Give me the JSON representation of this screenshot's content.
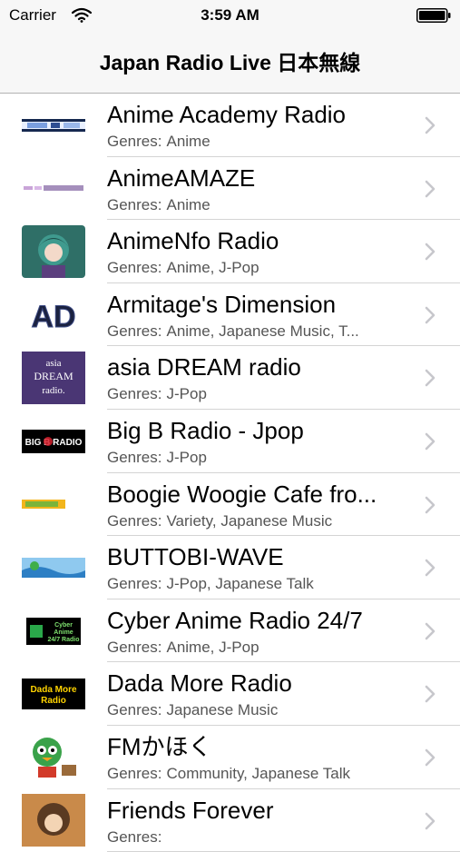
{
  "status_bar": {
    "carrier": "Carrier",
    "time": "3:59 AM",
    "icons": [
      "wifi-icon",
      "battery-icon"
    ]
  },
  "nav": {
    "title": "Japan Radio Live 日本無線"
  },
  "stations": [
    {
      "name": "Anime Academy Radio",
      "genres_label": "Genres:",
      "genres": "Anime",
      "logo_icon": "anime-academy-logo-icon"
    },
    {
      "name": "AnimeAMAZE",
      "genres_label": "Genres:",
      "genres": "Anime",
      "logo_icon": "animeamaze-logo-icon"
    },
    {
      "name": "AnimeNfo Radio",
      "genres_label": "Genres:",
      "genres": "Anime, J-Pop",
      "logo_icon": "animenfo-logo-icon"
    },
    {
      "name": "Armitage's Dimension",
      "genres_label": "Genres:",
      "genres": "Anime, Japanese Music, T...",
      "logo_icon": "armitage-logo-icon",
      "logo_text": "AD"
    },
    {
      "name": "asia DREAM radio",
      "genres_label": "Genres:",
      "genres": "J-Pop",
      "logo_icon": "asia-dream-logo-icon",
      "logo_text": "asia DREAM radio"
    },
    {
      "name": "Big B Radio - Jpop",
      "genres_label": "Genres:",
      "genres": "J-Pop",
      "logo_icon": "big-b-radio-logo-icon",
      "logo_text": "BIG B RADIO"
    },
    {
      "name": "Boogie Woogie Cafe fro...",
      "genres_label": "Genres:",
      "genres": "Variety, Japanese Music",
      "logo_icon": "boogie-woogie-logo-icon"
    },
    {
      "name": "BUTTOBI-WAVE",
      "genres_label": "Genres:",
      "genres": "J-Pop, Japanese Talk",
      "logo_icon": "buttobi-wave-logo-icon"
    },
    {
      "name": "Cyber Anime Radio 24/7",
      "genres_label": "Genres:",
      "genres": "Anime, J-Pop",
      "logo_icon": "cyber-anime-logo-icon",
      "logo_text": "Cyber Anime 24/7 Radio"
    },
    {
      "name": "Dada More Radio",
      "genres_label": "Genres:",
      "genres": "Japanese Music",
      "logo_icon": "dada-more-logo-icon",
      "logo_text": "Dada More Radio"
    },
    {
      "name": "FMかほく",
      "genres_label": "Genres:",
      "genres": "Community, Japanese Talk",
      "logo_icon": "fm-kahoku-logo-icon"
    },
    {
      "name": "Friends Forever",
      "genres_label": "Genres:",
      "genres": "",
      "logo_icon": "friends-forever-logo-icon"
    }
  ],
  "colors": {
    "bar_background": "#f7f7f7",
    "separator": "#d4d4d4",
    "subtitle": "#555555",
    "chevron": "#c7c7cc"
  }
}
